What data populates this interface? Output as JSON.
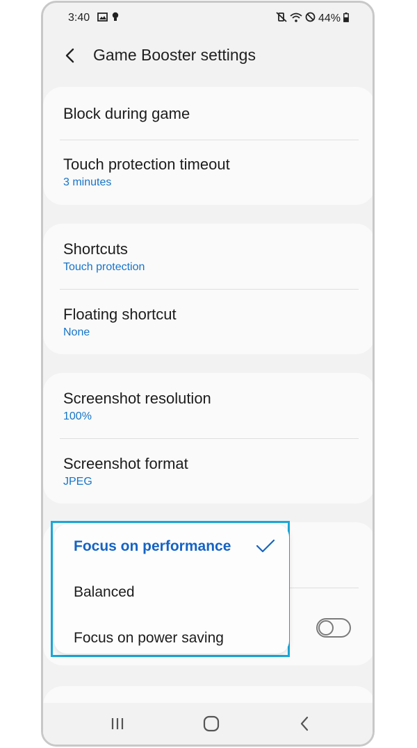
{
  "status_bar": {
    "time": "3:40",
    "left_icons": [
      "image-icon",
      "bulb-icon"
    ],
    "right_icons": [
      "mute-vibrate-icon",
      "wifi-icon",
      "do-not-disturb-icon"
    ],
    "battery": "44%"
  },
  "header": {
    "title": "Game Booster settings"
  },
  "groups": [
    {
      "items": [
        {
          "title": "Block during game"
        },
        {
          "title": "Touch protection timeout",
          "subtitle": "3 minutes"
        }
      ]
    },
    {
      "items": [
        {
          "title": "Shortcuts",
          "subtitle": "Touch protection"
        },
        {
          "title": "Floating shortcut",
          "subtitle": "None"
        }
      ]
    },
    {
      "items": [
        {
          "title": "Screenshot resolution",
          "subtitle": "100%"
        },
        {
          "title": "Screenshot format",
          "subtitle": "JPEG"
        }
      ]
    }
  ],
  "popup": {
    "options": [
      {
        "label": "Focus on performance",
        "selected": true
      },
      {
        "label": "Balanced",
        "selected": false
      },
      {
        "label": "Focus on power saving",
        "selected": false
      }
    ]
  },
  "toggle": {
    "on": false
  },
  "navbar": {
    "buttons": [
      "recents-icon",
      "home-icon",
      "back-nav-icon"
    ]
  },
  "colors": {
    "accent": "#1574c8",
    "highlight_border": "#1aa7d8",
    "background": "#f2f2f2",
    "card": "#fafafa"
  }
}
